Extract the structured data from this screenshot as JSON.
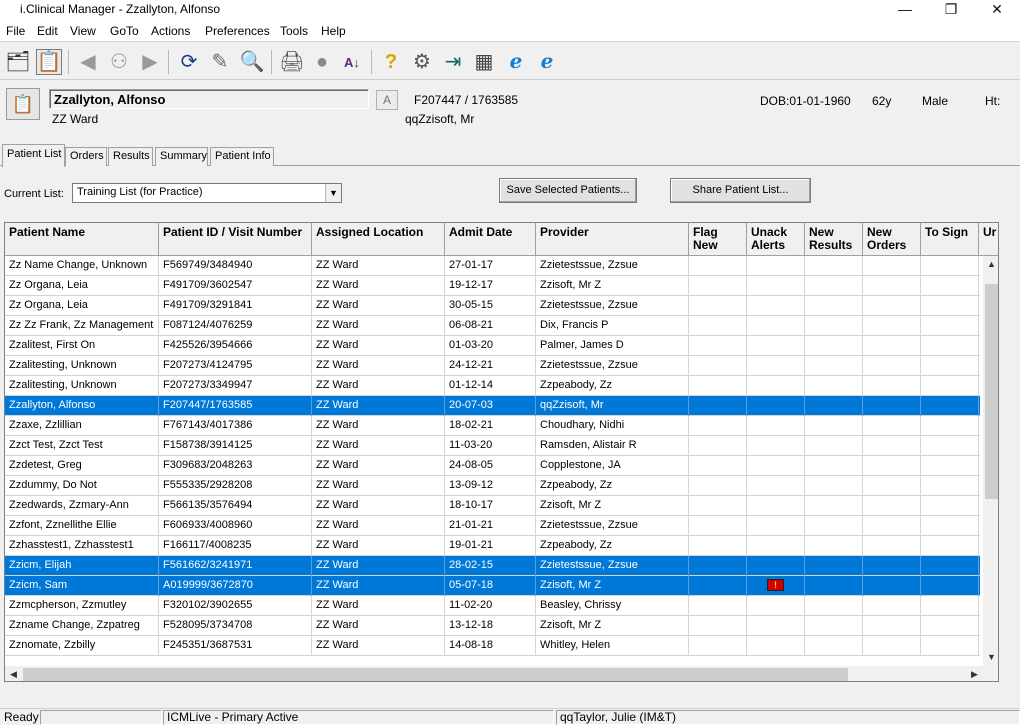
{
  "window": {
    "title": "i.Clinical Manager - Zzallyton, Alfonso",
    "min": "—",
    "max": "❐",
    "close": "✕"
  },
  "menu": [
    "File",
    "Edit",
    "View",
    "GoTo",
    "Actions",
    "Preferences",
    "Tools",
    "Help"
  ],
  "toolbar": {
    "icons": [
      "patient-list-icon",
      "patient-select-icon",
      "back-arrow-icon",
      "people-icon",
      "forward-arrow-icon",
      "refresh-icon",
      "notes-icon",
      "search-icon",
      "print-icon",
      "record-icon",
      "sort-az-icon",
      "help-icon",
      "settings-icon",
      "exit-icon",
      "calculator-icon",
      "browser-icon",
      "browser-icon-2"
    ],
    "glyphs": [
      "🗂",
      "📋",
      "◀",
      "⚇",
      "▶",
      "⟳",
      "✎",
      "🔍",
      "🖨",
      "●",
      "A↓",
      "?",
      "⚙",
      "⇥",
      "▦",
      "ℯ",
      "ℯ"
    ]
  },
  "banner": {
    "patient_name": "Zzallyton, Alfonso",
    "ward": "ZZ Ward",
    "a_label": "A",
    "patient_id": "F207447 / 1763585",
    "gp": "qqZzisoft, Mr",
    "dob": "DOB:01-01-1960",
    "age": "62y",
    "sex": "Male",
    "height": "Ht:"
  },
  "tabs": [
    "Patient List",
    "Orders",
    "Results",
    "Summary",
    "Patient Info"
  ],
  "current_list": {
    "label": "Current List:",
    "value": "Training List (for Practice)"
  },
  "buttons": {
    "save_selected": "Save Selected Patients...",
    "share_list": "Share Patient List..."
  },
  "columns": [
    "Patient Name",
    "Patient ID / Visit Number",
    "Assigned Location",
    "Admit Date",
    "Provider",
    "Flag\nNew",
    "Unack\nAlerts",
    "New\nResults",
    "New\nOrders",
    "To Sign",
    "Ur"
  ],
  "rows": [
    {
      "name": "Zz Name Change, Unknown",
      "id": "F569749/3484940",
      "loc": "ZZ Ward",
      "admit": "27-01-17",
      "provider": "Zzietestssue, Zzsue"
    },
    {
      "name": "Zz Organa, Leia",
      "id": "F491709/3602547",
      "loc": "ZZ Ward",
      "admit": "19-12-17",
      "provider": "Zzisoft, Mr Z"
    },
    {
      "name": "Zz Organa, Leia",
      "id": "F491709/3291841",
      "loc": "ZZ Ward",
      "admit": "30-05-15",
      "provider": "Zzietestssue, Zzsue"
    },
    {
      "name": "Zz Zz Frank, Zz Management",
      "id": "F087124/4076259",
      "loc": "ZZ Ward",
      "admit": "06-08-21",
      "provider": "Dix, Francis P"
    },
    {
      "name": "Zzalitest, First On",
      "id": "F425526/3954666",
      "loc": "ZZ Ward",
      "admit": "01-03-20",
      "provider": "Palmer, James D"
    },
    {
      "name": "Zzalitesting, Unknown",
      "id": "F207273/4124795",
      "loc": "ZZ Ward",
      "admit": "24-12-21",
      "provider": "Zzietestssue, Zzsue"
    },
    {
      "name": "Zzalitesting, Unknown",
      "id": "F207273/3349947",
      "loc": "ZZ Ward",
      "admit": "01-12-14",
      "provider": "Zzpeabody, Zz"
    },
    {
      "name": "Zzallyton, Alfonso",
      "id": "F207447/1763585",
      "loc": "ZZ Ward",
      "admit": "20-07-03",
      "provider": "qqZzisoft, Mr",
      "selected": true
    },
    {
      "name": "Zzaxe, Zzlillian",
      "id": "F767143/4017386",
      "loc": "ZZ Ward",
      "admit": "18-02-21",
      "provider": "Choudhary, Nidhi"
    },
    {
      "name": "Zzct Test, Zzct Test",
      "id": "F158738/3914125",
      "loc": "ZZ Ward",
      "admit": "11-03-20",
      "provider": "Ramsden, Alistair R"
    },
    {
      "name": "Zzdetest, Greg",
      "id": "F309683/2048263",
      "loc": "ZZ Ward",
      "admit": "24-08-05",
      "provider": "Copplestone, JA"
    },
    {
      "name": "Zzdummy, Do Not",
      "id": "F555335/2928208",
      "loc": "ZZ Ward",
      "admit": "13-09-12",
      "provider": "Zzpeabody, Zz"
    },
    {
      "name": "Zzedwards, Zzmary-Ann",
      "id": "F566135/3576494",
      "loc": "ZZ Ward",
      "admit": "18-10-17",
      "provider": "Zzisoft, Mr Z"
    },
    {
      "name": "Zzfont, Zznellithe Ellie",
      "id": "F606933/4008960",
      "loc": "ZZ Ward",
      "admit": "21-01-21",
      "provider": "Zzietestssue, Zzsue"
    },
    {
      "name": "Zzhasstest1, Zzhasstest1",
      "id": "F166117/4008235",
      "loc": "ZZ Ward",
      "admit": "19-01-21",
      "provider": "Zzpeabody, Zz"
    },
    {
      "name": "Zzicm, Elijah",
      "id": "F561662/3241971",
      "loc": "ZZ Ward",
      "admit": "28-02-15",
      "provider": "Zzietestssue, Zzsue",
      "selected": true
    },
    {
      "name": "Zzicm, Sam",
      "id": "A019999/3672870",
      "loc": "ZZ Ward",
      "admit": "05-07-18",
      "provider": "Zzisoft, Mr Z",
      "selected": true,
      "alert": "!"
    },
    {
      "name": "Zzmcpherson, Zzmutley",
      "id": "F320102/3902655",
      "loc": "ZZ Ward",
      "admit": "11-02-20",
      "provider": "Beasley, Chrissy"
    },
    {
      "name": "Zzname Change, Zzpatreg",
      "id": "F528095/3734708",
      "loc": "ZZ Ward",
      "admit": "13-12-18",
      "provider": "Zzisoft, Mr Z"
    },
    {
      "name": "Zznomate, Zzbilly",
      "id": "F245351/3687531",
      "loc": "ZZ Ward",
      "admit": "14-08-18",
      "provider": "Whitley, Helen"
    }
  ],
  "scroll": {
    "up": "▲",
    "down": "▼",
    "left": "◀",
    "right": "▶"
  },
  "status": {
    "ready": "Ready",
    "blank": "",
    "env": "ICMLive - Primary Active",
    "user": "qqTaylor, Julie (IM&T)"
  }
}
